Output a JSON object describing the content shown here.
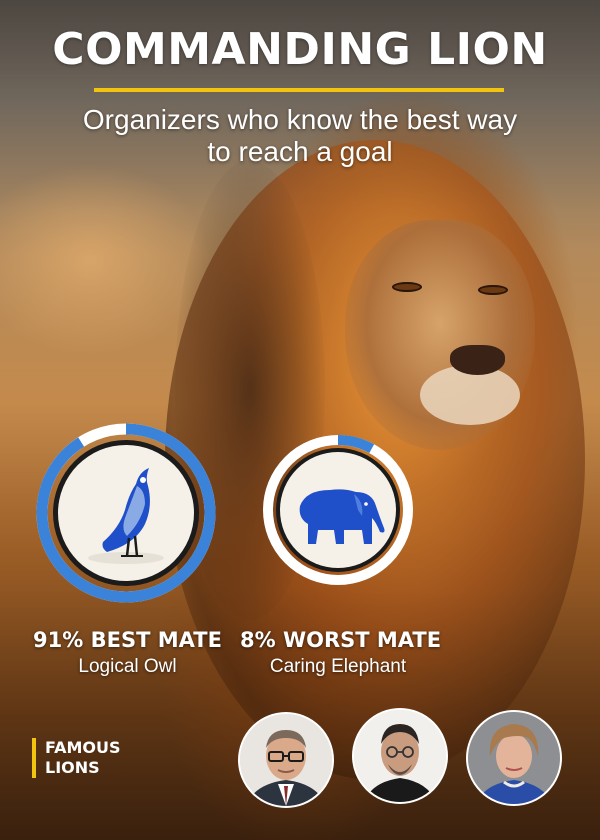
{
  "header": {
    "title": "COMMANDING LION",
    "subtitle_line1": "Organizers who know the best way",
    "subtitle_line2": "to reach a goal"
  },
  "best_mate": {
    "headline": "91% BEST MATE",
    "name": "Logical Owl",
    "percent": 91,
    "icon": "owl-icon"
  },
  "worst_mate": {
    "headline": "8% WORST MATE",
    "name": "Caring Elephant",
    "percent": 8,
    "icon": "elephant-icon"
  },
  "famous": {
    "label_line1": "FAMOUS",
    "label_line2": "LIONS"
  },
  "colors": {
    "accent_yellow": "#f1c40f",
    "ring_blue": "#3b82d9",
    "icon_blue": "#1f4fc9",
    "circle_cream": "#f5f1e8"
  }
}
